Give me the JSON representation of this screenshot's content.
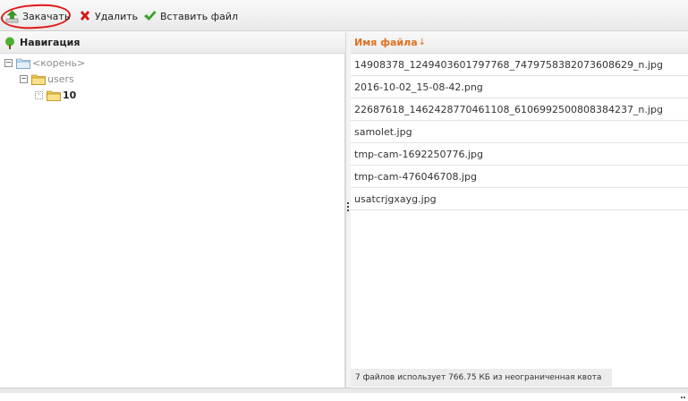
{
  "toolbar": {
    "upload_label": "Закачать",
    "delete_label": "Удалить",
    "paste_label": "Вставить файл"
  },
  "navigation": {
    "title": "Навигация",
    "tree": [
      {
        "label": "<корень>",
        "expanded": true
      },
      {
        "label": "users",
        "expanded": true
      },
      {
        "label": "10",
        "expanded": false,
        "selected": true
      }
    ]
  },
  "files": {
    "column_header": "Имя файла",
    "sort_indicator": "↓",
    "rows": [
      "14908378_1249403601797768_7479758382073608629_n.jpg",
      "2016-10-02_15-08-42.png",
      "22687618_1462428770461108_6106992500808384237_n.jpg",
      "samolet.jpg",
      "tmp-cam-1692250776.jpg",
      "tmp-cam-476046708.jpg",
      "usatcrjgxayg.jpg"
    ]
  },
  "status": {
    "text": "7 файлов использует 766.75 КБ из неограниченная квота"
  },
  "colors": {
    "accent_header": "#e07020",
    "annotation_circle": "#e01818",
    "upload_icon": "#3a9a2a",
    "delete_icon": "#d01818",
    "paste_icon": "#3aa02a",
    "folder": "#f2c94c"
  }
}
